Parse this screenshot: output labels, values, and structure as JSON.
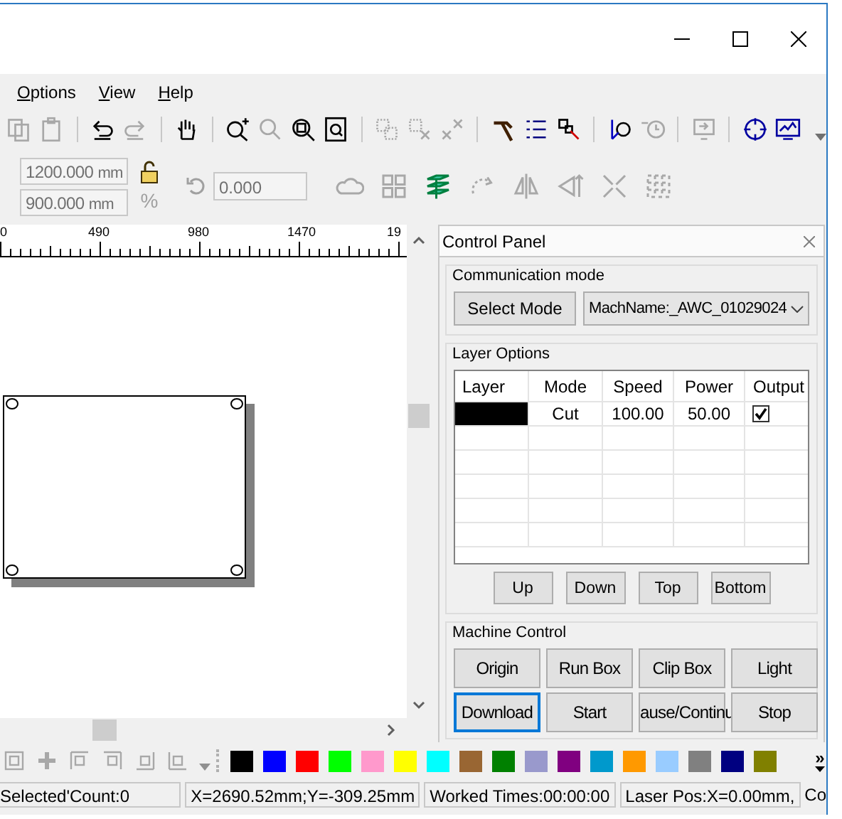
{
  "menu": [
    {
      "label": "Options"
    },
    {
      "label": "View"
    },
    {
      "label": "Help"
    }
  ],
  "toolbar": {
    "groups": [
      {
        "items": [
          {
            "kind": "copy",
            "disabled": true
          },
          {
            "kind": "clipboard",
            "disabled": true
          }
        ]
      },
      {
        "items": [
          {
            "kind": "undo",
            "disabled": false
          },
          {
            "kind": "redo",
            "disabled": true
          }
        ]
      },
      {
        "items": [
          {
            "kind": "hand",
            "disabled": false
          }
        ]
      },
      {
        "items": [
          {
            "kind": "zoom-in",
            "disabled": false
          },
          {
            "kind": "magnifier",
            "disabled": true
          },
          {
            "kind": "zoom-box",
            "disabled": false
          },
          {
            "kind": "page-zoom",
            "disabled": false
          }
        ]
      },
      {
        "items": [
          {
            "kind": "dotted-squares",
            "disabled": true
          },
          {
            "kind": "dotted-cross",
            "disabled": true
          },
          {
            "kind": "cross-nodes",
            "disabled": true
          }
        ]
      },
      {
        "items": [
          {
            "kind": "hammer",
            "disabled": false
          },
          {
            "kind": "list",
            "disabled": false
          },
          {
            "kind": "node-arrow",
            "disabled": false
          }
        ]
      },
      {
        "items": [
          {
            "kind": "node-circle",
            "disabled": false
          },
          {
            "kind": "clock",
            "disabled": true
          }
        ]
      },
      {
        "items": [
          {
            "kind": "monitor-arrow",
            "disabled": true
          }
        ]
      },
      {
        "items": [
          {
            "kind": "crosshair",
            "disabled": false
          },
          {
            "kind": "monitor",
            "disabled": false
          }
        ]
      }
    ]
  },
  "size_fields": [
    {
      "value": "1200.000",
      "unit": "mm"
    },
    {
      "value": "900.000",
      "unit": "mm"
    }
  ],
  "scale_label": "%",
  "rotation_field": {
    "value": "0.000"
  },
  "edit_toolbar": [
    {
      "kind": "cloud",
      "disabled": true
    },
    {
      "kind": "grid",
      "disabled": true
    },
    {
      "kind": "layers",
      "disabled": false
    },
    {
      "kind": "rotate-dots",
      "disabled": true
    },
    {
      "kind": "mirror",
      "disabled": true
    },
    {
      "kind": "align-arrow",
      "disabled": true
    },
    {
      "kind": "arrows",
      "disabled": true
    },
    {
      "kind": "checker",
      "disabled": true
    }
  ],
  "ruler": {
    "labels": [
      "0",
      "490",
      "980",
      "1470",
      "19"
    ]
  },
  "control_panel": {
    "title": "Control Panel",
    "communication": {
      "title": "Communication mode",
      "button": "Select Mode",
      "device": "MachName:_AWC_01029024"
    },
    "layer_options": {
      "title": "Layer Options",
      "columns": [
        "Layer",
        "Mode",
        "Speed",
        "Power",
        "Output"
      ],
      "rows": [
        {
          "color": "#000000",
          "mode": "Cut",
          "speed": "100.00",
          "power": "50.00",
          "output": true
        }
      ],
      "buttons": [
        "Up",
        "Down",
        "Top",
        "Bottom"
      ]
    },
    "machine_control": {
      "title": "Machine Control",
      "buttons": [
        {
          "label": "Origin",
          "focused": false
        },
        {
          "label": "Run Box",
          "focused": false
        },
        {
          "label": "Clip Box",
          "focused": false
        },
        {
          "label": "Light",
          "focused": false
        },
        {
          "label": "Download",
          "focused": true
        },
        {
          "label": "Start",
          "focused": false
        },
        {
          "label": "ause/Continu",
          "focused": false
        },
        {
          "label": "Stop",
          "focused": false
        }
      ]
    }
  },
  "align_toolbar": [
    {
      "kind": "frame",
      "disabled": true
    },
    {
      "kind": "plus",
      "disabled": true
    },
    {
      "kind": "align-top-left",
      "disabled": true
    },
    {
      "kind": "align-top-right",
      "disabled": true
    },
    {
      "kind": "align-bottom-right",
      "disabled": true
    },
    {
      "kind": "align-bottom-left",
      "disabled": true
    }
  ],
  "palette": {
    "colors": [
      {
        "color": "#000000"
      },
      {
        "color": "#0000ff"
      },
      {
        "color": "#ff0000"
      },
      {
        "color": "#00ff00"
      },
      {
        "color": "#ff99cc"
      },
      {
        "color": "#ffff00"
      },
      {
        "color": "#00ffff"
      },
      {
        "color": "#996633"
      },
      {
        "color": "#008000"
      },
      {
        "color": "#9999cc"
      },
      {
        "color": "#800080"
      },
      {
        "color": "#0099cc"
      },
      {
        "color": "#ff9900"
      },
      {
        "color": "#99ccff"
      },
      {
        "color": "#808080"
      },
      {
        "color": "#000080"
      },
      {
        "color": "#808000"
      }
    ],
    "overflow": "»"
  },
  "status_bar": [
    "Selected'Count:0",
    "X=2690.52mm;Y=-309.25mm",
    "Worked Times:00:00:00",
    "Laser Pos:X=0.00mm,",
    "Co"
  ]
}
